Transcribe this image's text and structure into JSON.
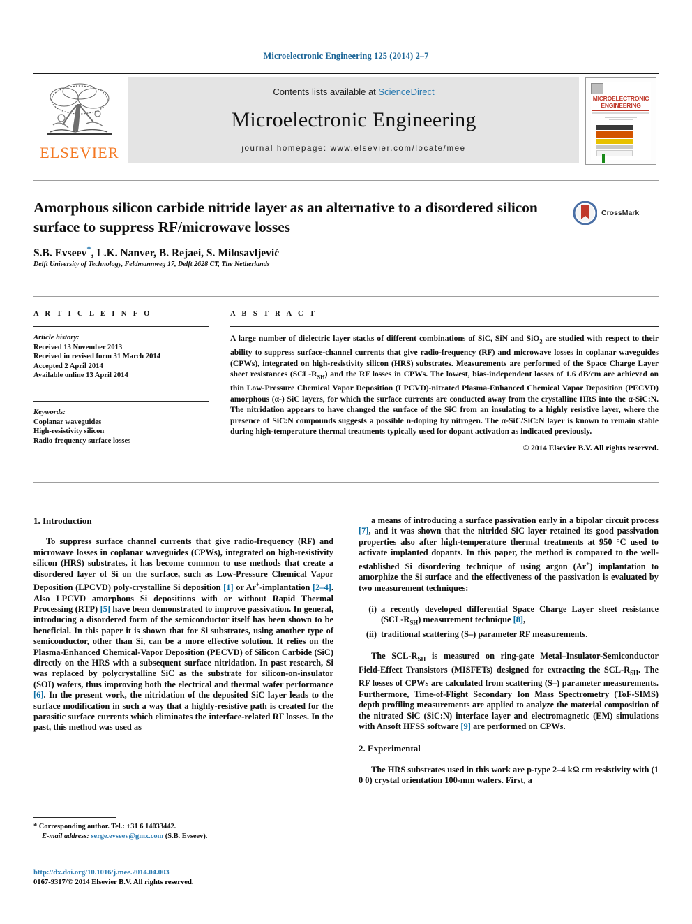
{
  "running_head": "Microelectronic Engineering 125 (2014) 2–7",
  "masthead": {
    "contents_prefix": "Contents lists available at ",
    "sciencedirect": "ScienceDirect",
    "journal_title": "Microelectronic Engineering",
    "homepage": "journal homepage: www.elsevier.com/locate/mee",
    "publisher": "ELSEVIER",
    "cover_title": "MICROELECTRONIC ENGINEERING",
    "accent_link": "#2a7ab0",
    "publisher_color": "#F47721"
  },
  "article": {
    "title": "Amorphous silicon carbide nitride layer as an alternative to a disordered silicon surface to suppress RF/microwave losses",
    "authors": "S.B. Evseev",
    "authors_rest": ", L.K. Nanver, B. Rejaei, S. Milosavljević",
    "corresponding_mark": "*",
    "affiliation": "Delft University of Technology, Feldmannweg 17, Delft 2628 CT, The Netherlands",
    "crossmark_label": "CrossMark"
  },
  "info": {
    "heading": "A R T I C L E    I N F O",
    "history_label": "Article history:",
    "history": [
      "Received 13 November 2013",
      "Received in revised form 31 March 2014",
      "Accepted 2 April 2014",
      "Available online 13 April 2014"
    ],
    "keywords_label": "Keywords:",
    "keywords": [
      "Coplanar waveguides",
      "High-resistivity silicon",
      "Radio-frequency surface losses"
    ]
  },
  "abstract": {
    "heading": "A B S T R A C T",
    "text_html": "A large number of dielectric layer stacks of different combinations of SiC, SiN and SiO<sub>2</sub> are studied with respect to their ability to suppress surface-channel currents that give radio-frequency (RF) and microwave losses in coplanar waveguides (CPWs), integrated on high-resistivity silicon (HRS) substrates. Measurements are performed of the Space Charge Layer sheet resistances (SCL-R<sub>SH</sub>) and the RF losses in CPWs. The lowest, bias-independent losses of 1.6 dB/cm are achieved on thin Low-Pressure Chemical Vapor Deposition (LPCVD)-nitrated Plasma-Enhanced Chemical Vapor Deposition (PECVD) amorphous (&#945;-) SiC layers, for which the surface currents are conducted away from the crystalline HRS into the &#945;-SiC:N. The nitridation appears to have changed the surface of the SiC from an insulating to a highly resistive layer, where the presence of SiC:N compounds suggests a possible n-doping by nitrogen. The &#945;-SiC/SiC:N layer is known to remain stable during high-temperature thermal treatments typically used for dopant activation as indicated previously.",
    "copyright": "© 2014 Elsevier B.V. All rights reserved."
  },
  "body": {
    "left": {
      "section_heading": "1. Introduction",
      "para1_html": "To suppress surface channel currents that give radio-frequency (RF) and microwave losses in coplanar waveguides (CPWs), integrated on high-resistivity silicon (HRS) substrates, it has become common to use methods that create a disordered layer of Si on the surface, such as Low-Pressure Chemical Vapor Deposition (LPCVD) poly-crystalline Si deposition <span class=\"ref\">[1]</span> or Ar<sup>+</sup>-implantation <span class=\"ref\">[2&#8211;4]</span>. Also LPCVD amorphous Si depositions with or without Rapid Thermal Processing (RTP) <span class=\"ref\">[5]</span> have been demonstrated to improve passivation. In general, introducing a disordered form of the semiconductor itself has been shown to be beneficial. In this paper it is shown that for Si substrates, using another type of semiconductor, other than Si, can be a more effective solution. It relies on the Plasma-Enhanced Chemical-Vapor Deposition (PECVD) of Silicon Carbide (SiC) directly on the HRS with a subsequent surface nitridation. In past research, Si was replaced by polycrystalline SiC as the substrate for silicon-on-insulator (SOI) wafers, thus improving both the electrical and thermal wafer performance <span class=\"ref\">[6]</span>. In the present work, the nitridation of the deposited SiC layer leads to the surface modification in such a way that a highly-resistive path is created for the parasitic surface currents which eliminates the interface-related RF losses. In the past, this method was used as"
    },
    "right": {
      "para1_html": "a means of introducing a surface passivation early in a bipolar circuit process <span class=\"ref\">[7]</span>, and it was shown that the nitrided SiC layer retained its good passivation properties also after high-temperature thermal treatments at 950 &#176;C used to activate implanted dopants. In this paper, the method is compared to the well-established Si disordering technique of using argon (Ar<sup>+</sup>) implantation to amorphize the Si surface and the effectiveness of the passivation is evaluated by two measurement techniques:",
      "list": [
        {
          "num": "(i)",
          "text_html": "a recently developed differential Space Charge Layer sheet resistance (SCL-R<sub>SH</sub>) measurement technique <span class=\"ref\">[8]</span>,"
        },
        {
          "num": "(ii)",
          "text_html": "traditional scattering (S&#8211;) parameter RF measurements."
        }
      ],
      "para2_html": "The SCL-R<sub>SH</sub> is measured on ring-gate Metal&#8211;Insulator-Semiconductor Field-Effect Transistors (MISFETs) designed for extracting the SCL-R<sub>SH</sub>. The RF losses of CPWs are calculated from scattering (S&#8211;) parameter measurements. Furthermore, Time-of-Flight Secondary Ion Mass Spectrometry (ToF-SIMS) depth profiling measurements are applied to analyze the material composition of the nitrated SiC (SiC:N) interface layer and electromagnetic (EM) simulations with Ansoft HFSS software <span class=\"ref\">[9]</span> are performed on CPWs.",
      "section_heading": "2. Experimental",
      "para3_html": "The HRS substrates used in this work are p-type 2&#8211;4 k&#937; cm resistivity with (1 0 0) crystal orientation 100-mm wafers. First, a"
    }
  },
  "footnote": {
    "corresponding": "* Corresponding author. Tel.: +31 6 14033442.",
    "email_label": "E-mail address:",
    "email": "serge.evseev@gmx.com",
    "email_suffix": " (S.B. Evseev)."
  },
  "footer": {
    "doi": "http://dx.doi.org/10.1016/j.mee.2014.04.003",
    "issn_line": "0167-9317/© 2014 Elsevier B.V. All rights reserved."
  }
}
